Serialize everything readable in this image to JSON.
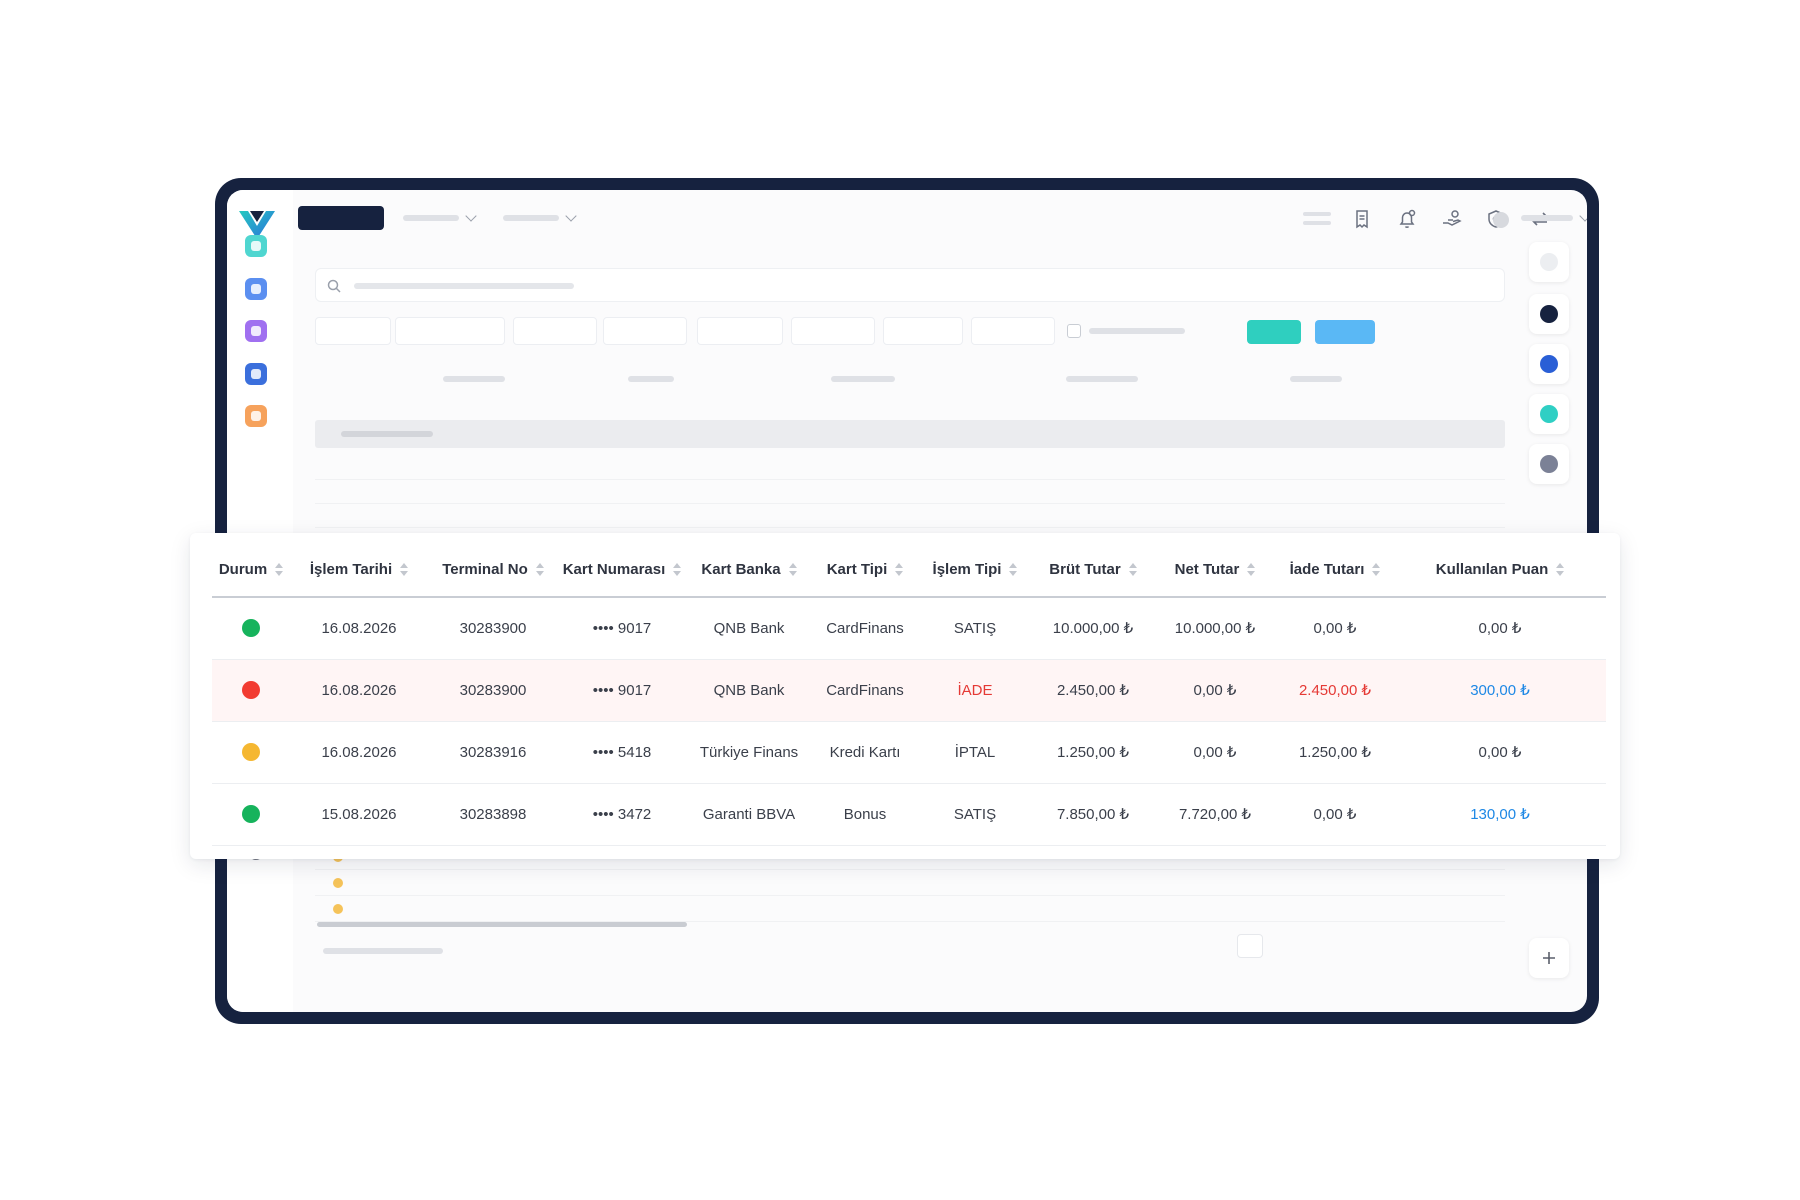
{
  "colors": {
    "frame": "#16223f",
    "accent_teal": "#2fcfbf",
    "accent_blue": "#5ab8f5",
    "status_success": "#16b35c",
    "status_refund": "#f23b31",
    "status_cancel": "#f5b731",
    "refund_row_bg": "#fff5f5",
    "refund_text": "#e53935",
    "points_text": "#1e88e5"
  },
  "icons": {
    "topbar": [
      "menu-lines-icon",
      "receipt-icon",
      "bell-icon",
      "hand-money-icon",
      "shield-icon",
      "swap-icon"
    ],
    "leftnav_bottom": [
      "gift-icon",
      "settings-icon",
      "help-icon"
    ],
    "rightrail_bottom": "plus-icon"
  },
  "table": {
    "columns": [
      {
        "label": "Durum"
      },
      {
        "label": "İşlem Tarihi"
      },
      {
        "label": "Terminal No"
      },
      {
        "label": "Kart Numarası"
      },
      {
        "label": "Kart Banka"
      },
      {
        "label": "Kart Tipi"
      },
      {
        "label": "İşlem Tipi"
      },
      {
        "label": "Brüt Tutar"
      },
      {
        "label": "Net Tutar"
      },
      {
        "label": "İade Tutarı"
      },
      {
        "label": "Kullanılan Puan"
      }
    ],
    "rows": [
      {
        "status": "success",
        "date": "16.08.2026",
        "terminal": "30283900",
        "card": "•••• 9017",
        "bank": "QNB Bank",
        "card_type": "CardFinans",
        "tx_type": "SATIŞ",
        "gross": "10.000,00 ₺",
        "net": "10.000,00 ₺",
        "refund": "0,00 ₺",
        "points": "0,00 ₺"
      },
      {
        "status": "refund",
        "date": "16.08.2026",
        "terminal": "30283900",
        "card": "•••• 9017",
        "bank": "QNB Bank",
        "card_type": "CardFinans",
        "tx_type": "İADE",
        "gross": "2.450,00 ₺",
        "net": "0,00 ₺",
        "refund": "2.450,00 ₺",
        "points": "300,00 ₺"
      },
      {
        "status": "cancel",
        "date": "16.08.2026",
        "terminal": "30283916",
        "card": "•••• 5418",
        "bank": "Türkiye Finans",
        "card_type": "Kredi Kartı",
        "tx_type": "İPTAL",
        "gross": "1.250,00 ₺",
        "net": "0,00 ₺",
        "refund": "1.250,00 ₺",
        "points": "0,00 ₺"
      },
      {
        "status": "success",
        "date": "15.08.2026",
        "terminal": "30283898",
        "card": "•••• 3472",
        "bank": "Garanti BBVA",
        "card_type": "Bonus",
        "tx_type": "SATIŞ",
        "gross": "7.850,00 ₺",
        "net": "7.720,00 ₺",
        "refund": "0,00 ₺",
        "points": "130,00 ₺"
      }
    ]
  }
}
